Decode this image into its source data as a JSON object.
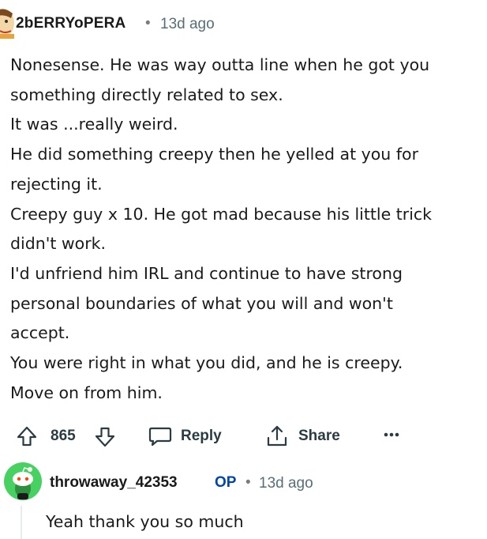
{
  "comment": {
    "username": "2bERRYoPERA",
    "separator": "•",
    "timestamp": "13d ago",
    "body_lines": [
      "Nonesense. He was way outta line when he got you",
      "something directly related to sex.",
      "It was ...really weird.",
      "He did something creepy then he yelled at you for",
      "rejecting it.",
      "Creepy guy x 10. He got mad because his little trick",
      "didn't work.",
      "I'd unfriend him IRL and continue to have strong",
      "personal boundaries of what you will and won't",
      "accept.",
      "You were right in what you did, and he is creepy.",
      "Move on from him."
    ],
    "actions": {
      "upvote_icon": "upvote-arrow-icon",
      "score": "865",
      "downvote_icon": "downvote-arrow-icon",
      "reply_icon": "speech-bubble-icon",
      "reply_label": "Reply",
      "share_icon": "share-upload-icon",
      "share_label": "Share",
      "more_icon": "ellipsis-icon"
    }
  },
  "reply": {
    "username": "throwaway_42353",
    "op_badge": "OP",
    "separator": "•",
    "timestamp": "13d ago",
    "text": "Yeah thank you so much",
    "avatar_color": "#46d160"
  },
  "colors": {
    "text": "#1a1a1b",
    "muted": "#576f76",
    "op_blue": "#0045ac",
    "thread_line": "#e5ebee"
  }
}
